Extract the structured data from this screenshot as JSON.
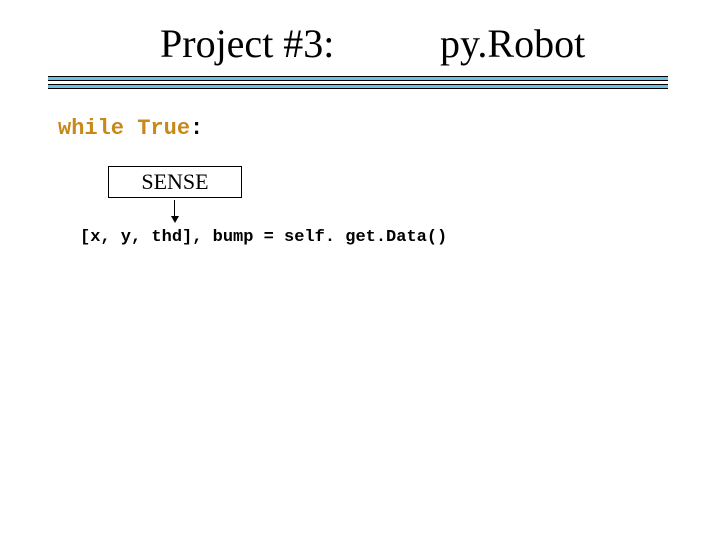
{
  "title": {
    "left": "Project #3:",
    "right": "py.Robot"
  },
  "code": {
    "while_keyword": "while",
    "true_keyword": "True",
    "colon": ":",
    "sense_label": "SENSE",
    "data_line": "[x, y, thd], bump = self. get.Data()"
  }
}
